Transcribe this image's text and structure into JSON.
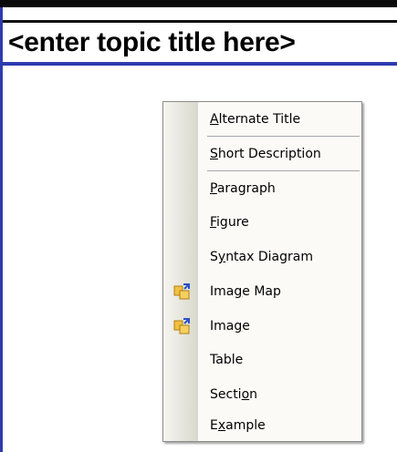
{
  "title": "<enter topic title here>",
  "menu": {
    "items": [
      {
        "label": "Alternate Title",
        "mnemonic": "A",
        "icon": null
      },
      {
        "label": "Short Description",
        "mnemonic": "S",
        "icon": null
      },
      {
        "label": "Paragraph",
        "mnemonic": "P",
        "icon": null
      },
      {
        "label": "Figure",
        "mnemonic": "F",
        "icon": null
      },
      {
        "label": "Syntax Diagram",
        "mnemonic": "y",
        "icon": null
      },
      {
        "label": "Image Map",
        "mnemonic": "g",
        "icon": "image-insert-icon"
      },
      {
        "label": "Image",
        "mnemonic": "g",
        "icon": "image-insert-icon"
      },
      {
        "label": "Table",
        "mnemonic": "",
        "icon": null
      },
      {
        "label": "Section",
        "mnemonic": "o",
        "icon": null
      },
      {
        "label": "Example",
        "mnemonic": "x",
        "icon": null
      }
    ]
  },
  "colors": {
    "frame_blue": "#2e3bb0",
    "menu_bg": "#fbfaf7"
  }
}
